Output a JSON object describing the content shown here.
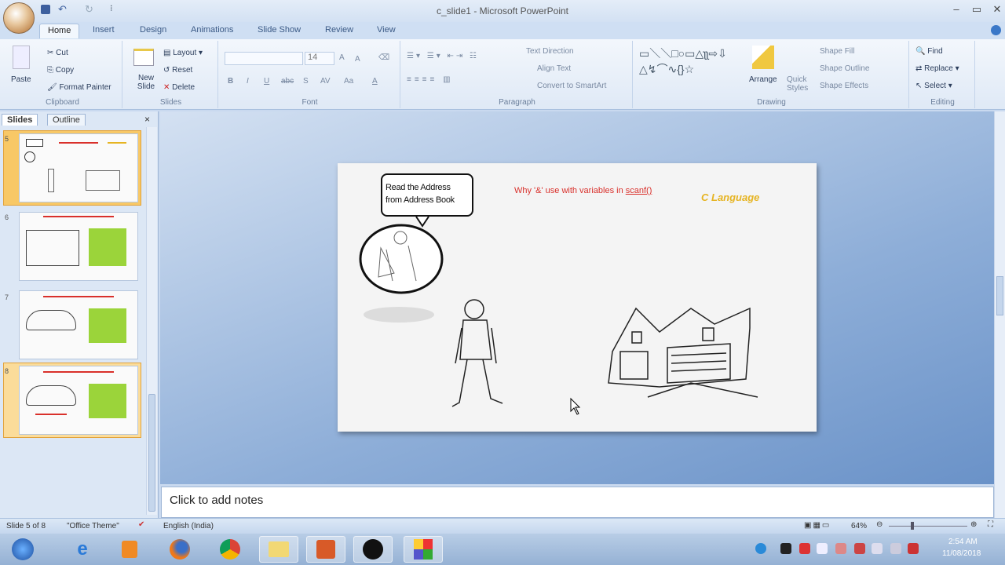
{
  "window": {
    "title": "c_slide1 - Microsoft PowerPoint",
    "min": "–",
    "max": "▭",
    "close": "✕"
  },
  "qat": {
    "save": "save",
    "undo": "undo",
    "redo": "redo",
    "more": "⁝"
  },
  "tabs": [
    "Home",
    "Insert",
    "Design",
    "Animations",
    "Slide Show",
    "Review",
    "View"
  ],
  "ribbon": {
    "clipboard": {
      "paste": "Paste",
      "cut": "Cut",
      "copy": "Copy",
      "format_painter": "Format Painter",
      "label": "Clipboard"
    },
    "slides": {
      "new_slide": "New Slide",
      "layout": "Layout",
      "reset": "Reset",
      "delete": "Delete",
      "label": "Slides"
    },
    "font": {
      "font_name": "",
      "font_size": "14",
      "bold": "B",
      "italic": "I",
      "underline": "U",
      "strike": "abc",
      "shadow": "S",
      "spacing": "AV",
      "case": "Aa",
      "color": "A",
      "grow": "A",
      "shrink": "A",
      "label": "Font"
    },
    "paragraph": {
      "text_direction": "Text Direction",
      "align_text": "Align Text",
      "convert_smartart": "Convert to SmartArt",
      "label": "Paragraph"
    },
    "drawing": {
      "arrange": "Arrange",
      "quick_styles": "Quick Styles",
      "shape_fill": "Shape Fill",
      "shape_outline": "Shape Outline",
      "shape_effects": "Shape Effects",
      "label": "Drawing",
      "shapes": "▭＼＼□○▭△ʅʅ⇨⇩△↯⌒∿{}☆"
    },
    "editing": {
      "find": "Find",
      "replace": "Replace",
      "select": "Select",
      "label": "Editing"
    }
  },
  "left_pane": {
    "tab_slides": "Slides",
    "tab_outline": "Outline",
    "close": "×",
    "slides": [
      {
        "num": "5"
      },
      {
        "num": "6"
      },
      {
        "num": "7"
      },
      {
        "num": "8"
      }
    ],
    "selected": "5"
  },
  "slide": {
    "bubble_line1": "Read the Address",
    "bubble_line2": "from Address Book",
    "heading_prefix": "Why '&' use with variables in ",
    "heading_func": "scanf()",
    "badge": "C Language",
    "heading_color": "#d9302b",
    "badge_color": "#e6b422"
  },
  "notes": {
    "placeholder": "Click to add notes"
  },
  "status": {
    "slide": "Slide 5 of 8",
    "theme": "\"Office Theme\"",
    "language": "English (India)",
    "zoom": "64%"
  },
  "taskbar": {
    "time": "2:54 AM",
    "date": "11/08/2018",
    "apps": [
      "start",
      "internet-explorer",
      "media-player",
      "firefox",
      "chrome",
      "file-explorer",
      "powerpoint",
      "media-app",
      "multicolor-app"
    ]
  }
}
